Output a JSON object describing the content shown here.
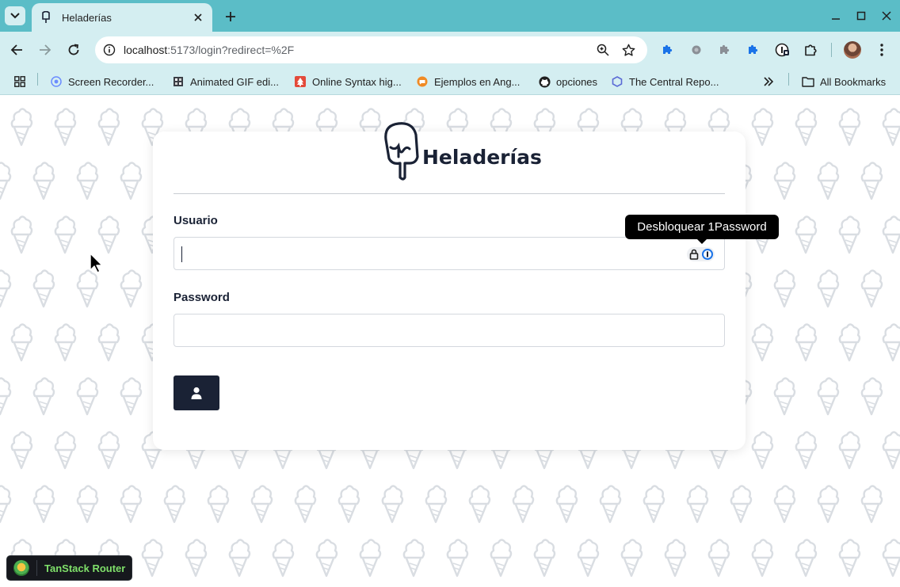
{
  "browser": {
    "tab": {
      "title": "Heladerías"
    },
    "omnibox": {
      "host": "localhost",
      "path": ":5173/login?redirect=%2F"
    },
    "bookmarks": [
      {
        "label": "Screen Recorder..."
      },
      {
        "label": "Animated GIF edi..."
      },
      {
        "label": "Online Syntax hig..."
      },
      {
        "label": "Ejemplos en Ang..."
      },
      {
        "label": "opciones"
      },
      {
        "label": "The Central Repo..."
      }
    ],
    "all_bookmarks_label": "All Bookmarks"
  },
  "login": {
    "brand": "Heladerías",
    "username_label": "Usuario",
    "username_value": "",
    "password_label": "Password",
    "password_value": ""
  },
  "tooltip": {
    "text": "Desbloquear 1Password"
  },
  "devtools": {
    "label": "TanStack Router"
  },
  "colors": {
    "tabbar": "#5bbdc7",
    "toolbar": "#d4eef1",
    "primary": "#1a2235",
    "pattern": "#d9dde2",
    "devtools_accent": "#7fe06a"
  },
  "icons": {
    "tab_favicon": "popsicle-icon",
    "extensions": [
      "puzzle-icon",
      "circle-extension-icon",
      "puzzle-gray-icon",
      "puzzle-blue-icon",
      "onepassword-icon",
      "extensions-icon"
    ],
    "submit": "user-icon"
  }
}
